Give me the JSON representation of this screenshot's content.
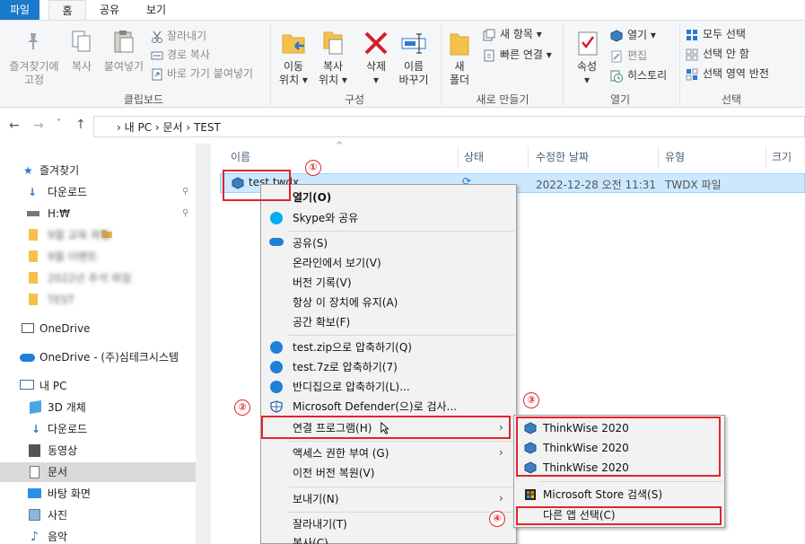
{
  "ribbon_tabs": [
    "파일",
    "홈",
    "공유",
    "보기"
  ],
  "clipboard": {
    "pin": "즐겨찾기에\n고정",
    "copy": "복사",
    "paste": "붙여넣기",
    "cut": "잘라내기",
    "copy_path": "경로 복사",
    "paste_shortcut": "바로 가기 붙여넣기",
    "group": "클립보드"
  },
  "organize": {
    "move": "이동\n위치 ▾",
    "copyto": "복사\n위치 ▾",
    "delete": "삭제\n▾",
    "rename": "이름\n바꾸기",
    "group": "구성"
  },
  "new": {
    "folder": "새\n폴더",
    "new_item": "새 항목 ▾",
    "easy_access": "빠른 연결 ▾",
    "group": "새로 만들기"
  },
  "open": {
    "properties": "속성\n▾",
    "open": "열기 ▾",
    "edit": "편집",
    "history": "히스토리",
    "group": "열기"
  },
  "select": {
    "all": "모두 선택",
    "none": "선택 안 함",
    "invert": "선택 영역 반전",
    "group": "선택"
  },
  "address": {
    "path": "›  내 PC  ›  문서  ›  TEST"
  },
  "nav": {
    "quick_access": "즐겨찾기",
    "downloads": "다운로드",
    "hdrive": "H:₩",
    "blur1": "9월 교육 파일",
    "blur2": "9월 이벤트",
    "blur3": "2022년 추석 파일",
    "blur4": "TEST",
    "onedrive": "OneDrive",
    "onedrive_org": "OneDrive - (주)심테크시스템",
    "this_pc": "내 PC",
    "objects3d": "3D 개체",
    "downloads2": "다운로드",
    "videos": "동영상",
    "documents": "문서",
    "desktop": "바탕 화면",
    "pictures": "사진",
    "music": "음악"
  },
  "columns": {
    "name": "이름",
    "status": "상태",
    "modified": "수정한 날짜",
    "type": "유형",
    "size": "크기"
  },
  "file": {
    "name": "test.twdx",
    "modified": "2022-12-28 오전 11:31",
    "type": "TWDX 파일"
  },
  "context_menu": {
    "open": "열기(O)",
    "skype": "Skype와 공유",
    "share": "공유(S)",
    "view_online": "온라인에서 보기(V)",
    "version_history": "버전 기록(V)",
    "keep_device": "항상 이 장치에 유지(A)",
    "free_space": "공간 확보(F)",
    "zip": "test.zip으로 압축하기(Q)",
    "sevenz": "test.7z로 압축하기(7)",
    "bandizip": "반디집으로 압축하기(L)...",
    "defender": "Microsoft Defender(으)로 검사...",
    "open_with": "연결 프로그램(H)",
    "grant_access": "액세스 권한 부여 (G)",
    "restore": "이전 버전 복원(V)",
    "send_to": "보내기(N)",
    "cut": "잘라내기(T)",
    "copy_partial": "복사(C)"
  },
  "submenu": {
    "app1": "ThinkWise 2020",
    "app2": "ThinkWise 2020",
    "app3": "ThinkWise 2020",
    "store": "Microsoft Store 검색(S)",
    "other": "다른 앱 선택(C)"
  },
  "badges": [
    "①",
    "②",
    "③",
    "④"
  ],
  "colors": {
    "accent": "#1979ca",
    "highlight": "#e0252c",
    "selection": "#cce8ff"
  }
}
